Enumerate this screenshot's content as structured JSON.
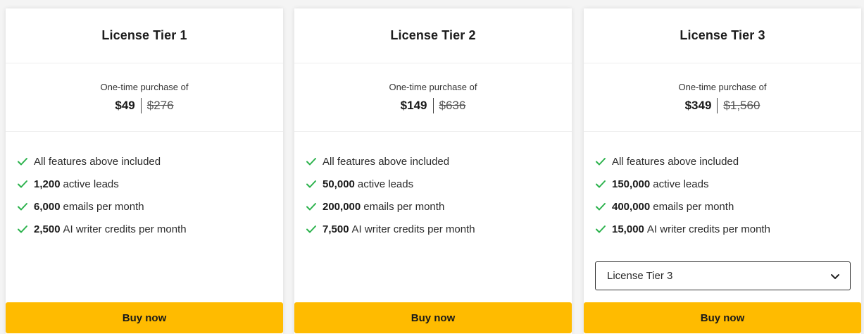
{
  "colors": {
    "accent": "#ffbb00",
    "check": "#2bb24c",
    "background": "#f4f4f4",
    "card": "#ffffff"
  },
  "icons": {
    "feature": "check-icon",
    "select": "chevron-down-icon"
  },
  "tiers": [
    {
      "title": "License Tier 1",
      "price_caption": "One-time purchase of",
      "price": "$49",
      "old_price": "$276",
      "features": [
        {
          "bold": "",
          "text": "All features above included"
        },
        {
          "bold": "1,200",
          "text": "active leads"
        },
        {
          "bold": "6,000",
          "text": "emails per month"
        },
        {
          "bold": "2,500",
          "text": "AI writer credits per month"
        }
      ],
      "button_label": "Buy now"
    },
    {
      "title": "License Tier 2",
      "price_caption": "One-time purchase of",
      "price": "$149",
      "old_price": "$636",
      "features": [
        {
          "bold": "",
          "text": "All features above included"
        },
        {
          "bold": "50,000",
          "text": "active leads"
        },
        {
          "bold": "200,000",
          "text": "emails per month"
        },
        {
          "bold": "7,500",
          "text": "AI writer credits per month"
        }
      ],
      "button_label": "Buy now"
    },
    {
      "title": "License Tier 3",
      "price_caption": "One-time purchase of",
      "price": "$349",
      "old_price": "$1,560",
      "features": [
        {
          "bold": "",
          "text": "All features above included"
        },
        {
          "bold": "150,000",
          "text": "active leads"
        },
        {
          "bold": "400,000",
          "text": "emails per month"
        },
        {
          "bold": "15,000",
          "text": "AI writer credits per month"
        }
      ],
      "select_value": "License Tier 3",
      "button_label": "Buy now"
    }
  ]
}
